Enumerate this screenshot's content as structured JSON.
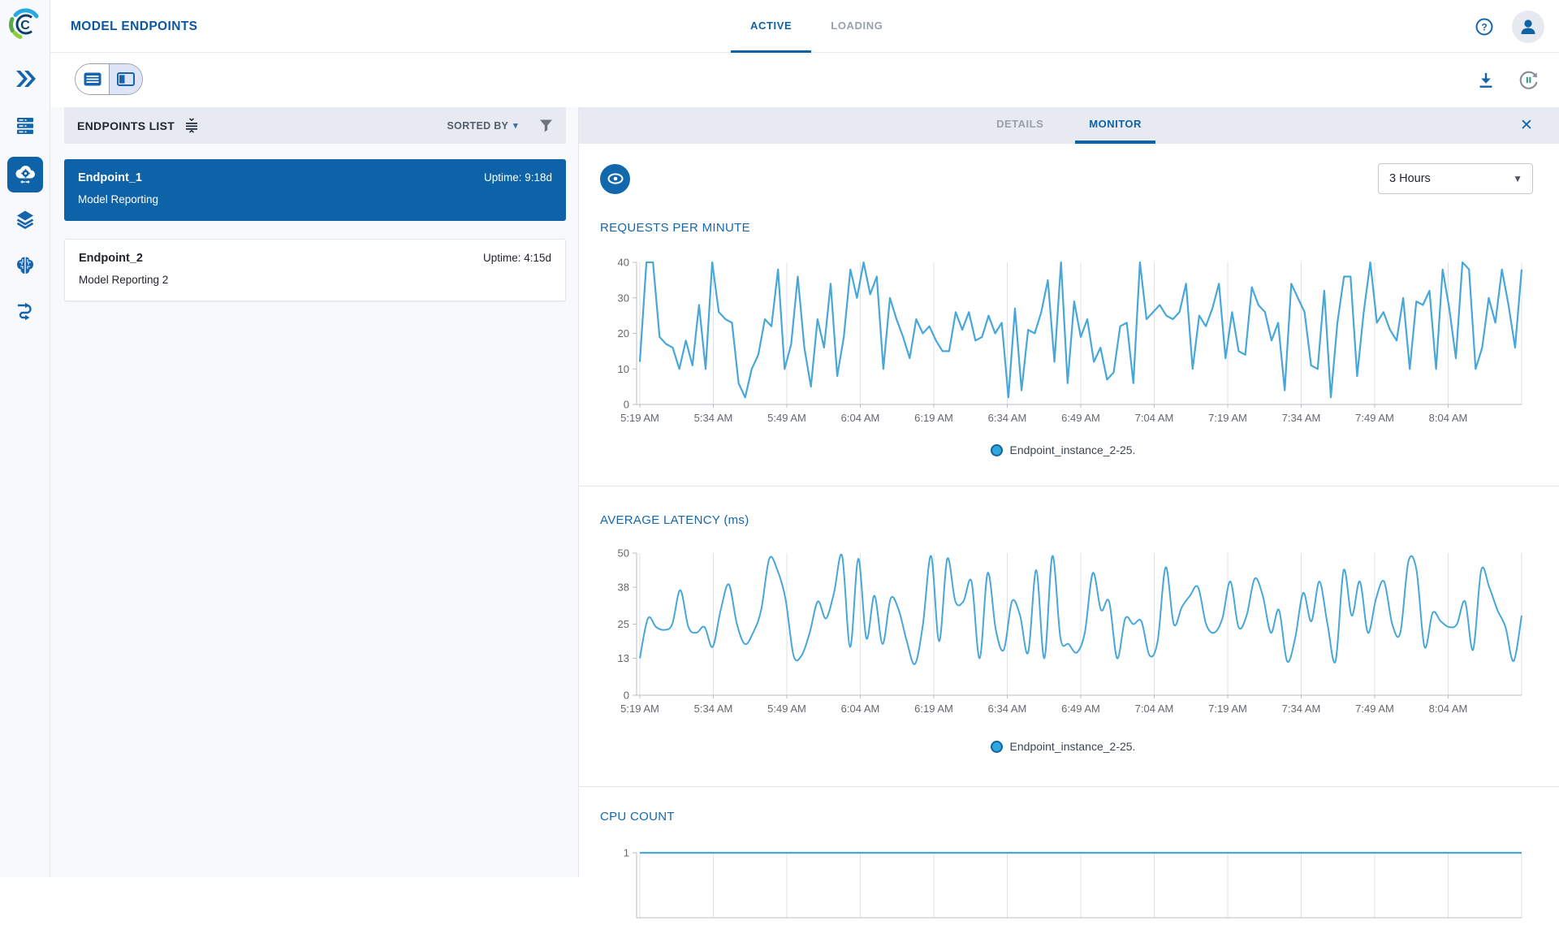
{
  "app": {
    "title": "MODEL ENDPOINTS",
    "tabs": [
      {
        "label": "ACTIVE",
        "active": true
      },
      {
        "label": "LOADING",
        "active": false
      }
    ],
    "help_glyph": "?",
    "colors": {
      "primary": "#0d62a8",
      "chart_line": "#47a7d8",
      "header_bar": "#e8eaf1",
      "panel_bg": "#f8f9fb"
    }
  },
  "sidebar": {
    "items": [
      {
        "icon": "double-chevron-right-icon",
        "active": false
      },
      {
        "icon": "hosts-icon",
        "active": false
      },
      {
        "icon": "cloud-gear-icon",
        "active": true
      },
      {
        "icon": "layers-icon",
        "active": false
      },
      {
        "icon": "brain-icon",
        "active": false
      },
      {
        "icon": "flow-icon",
        "active": false
      }
    ]
  },
  "toolbar": {
    "view_modes": [
      {
        "icon": "list-view-icon",
        "selected": false
      },
      {
        "icon": "split-view-icon",
        "selected": true
      }
    ],
    "right_icons": [
      "download-icon",
      "auto-refresh-pause-icon"
    ]
  },
  "endpoints_panel": {
    "header": "ENDPOINTS LIST",
    "sorted_by_label": "SORTED BY",
    "sorted_by_caret": "▾",
    "endpoints": [
      {
        "name": "Endpoint_1",
        "uptime": "Uptime: 9:18d",
        "description": "Model Reporting",
        "selected": true
      },
      {
        "name": "Endpoint_2",
        "uptime": "Uptime: 4:15d",
        "description": "Model Reporting 2",
        "selected": false
      }
    ]
  },
  "detail_panel": {
    "tabs": [
      {
        "label": "DETAILS",
        "active": false
      },
      {
        "label": "MONITOR",
        "active": true
      }
    ],
    "close_glyph": "✕",
    "time_range": "3 Hours",
    "select_caret": "▼"
  },
  "chart_data": [
    {
      "type": "line",
      "title": "REQUESTS PER MINUTE",
      "x_ticks": [
        "5:19 AM",
        "5:34 AM",
        "5:49 AM",
        "6:04 AM",
        "6:19 AM",
        "6:34 AM",
        "6:49 AM",
        "7:04 AM",
        "7:19 AM",
        "7:34 AM",
        "7:49 AM",
        "8:04 AM"
      ],
      "y_ticks": [
        0,
        10,
        20,
        30,
        40
      ],
      "ylim": [
        0,
        40
      ],
      "grid": "vertical",
      "legend_position": "bottom",
      "series": [
        {
          "name": "Endpoint_instance_2-25.",
          "color": "#47a7d8",
          "values": [
            12,
            40,
            40,
            19,
            17,
            16,
            10,
            18,
            11,
            28,
            10,
            40,
            26,
            24,
            23,
            6,
            2,
            10,
            14,
            24,
            22,
            38,
            10,
            17,
            36,
            16,
            5,
            24,
            16,
            34,
            8,
            19,
            38,
            30,
            40,
            31,
            36,
            10,
            30,
            24,
            19,
            13,
            24,
            20,
            22,
            18,
            15,
            15,
            26,
            21,
            26,
            18,
            19,
            25,
            20,
            23,
            2,
            27,
            4,
            21,
            20,
            26,
            35,
            12,
            40,
            6,
            29,
            19,
            24,
            12,
            16,
            7,
            9,
            22,
            23,
            6,
            40,
            24,
            26,
            28,
            25,
            24,
            26,
            34,
            10,
            25,
            22,
            27,
            34,
            13,
            26,
            15,
            14,
            33,
            28,
            26,
            18,
            23,
            4,
            34,
            30,
            26,
            11,
            10,
            32,
            2,
            23,
            36,
            36,
            8,
            26,
            40,
            23,
            26,
            21,
            18,
            30,
            10,
            29,
            28,
            32,
            10,
            38,
            27,
            13,
            40,
            38,
            10,
            16,
            30,
            23,
            38,
            28,
            16,
            38
          ]
        }
      ]
    },
    {
      "type": "line",
      "title": "AVERAGE LATENCY (ms)",
      "x_ticks": [
        "5:19 AM",
        "5:34 AM",
        "5:49 AM",
        "6:04 AM",
        "6:19 AM",
        "6:34 AM",
        "6:49 AM",
        "7:04 AM",
        "7:19 AM",
        "7:34 AM",
        "7:49 AM",
        "8:04 AM"
      ],
      "y_ticks": [
        0,
        13,
        25,
        38,
        50
      ],
      "ylim": [
        0,
        50
      ],
      "grid": "vertical",
      "legend_position": "bottom",
      "series": [
        {
          "name": "Endpoint_instance_2-25.",
          "color": "#47a7d8",
          "values": [
            13,
            27,
            24,
            23,
            25,
            37,
            24,
            22,
            24,
            17,
            30,
            39,
            25,
            18,
            22,
            30,
            48,
            44,
            34,
            14,
            14,
            22,
            33,
            27,
            36,
            49,
            17,
            48,
            20,
            35,
            18,
            34,
            30,
            19,
            11,
            25,
            49,
            19,
            48,
            33,
            33,
            40,
            13,
            43,
            23,
            16,
            33,
            28,
            15,
            44,
            13,
            49,
            20,
            18,
            15,
            22,
            43,
            30,
            33,
            13,
            27,
            25,
            26,
            14,
            19,
            45,
            25,
            31,
            35,
            38,
            25,
            22,
            27,
            40,
            24,
            28,
            41,
            35,
            22,
            30,
            12,
            20,
            36,
            26,
            40,
            25,
            12,
            44,
            28,
            40,
            22,
            34,
            40,
            25,
            22,
            47,
            44,
            17,
            29,
            26,
            24,
            25,
            33,
            16,
            44,
            38,
            30,
            24,
            12,
            28
          ]
        }
      ]
    },
    {
      "type": "line",
      "title": "CPU COUNT",
      "x_ticks": [],
      "y_ticks": [
        1
      ],
      "ylim": [
        0,
        1
      ],
      "grid": "vertical",
      "series": [
        {
          "name": "Endpoint_instance_2-25.",
          "color": "#47a7d8",
          "values": [
            1,
            1
          ]
        }
      ]
    }
  ]
}
